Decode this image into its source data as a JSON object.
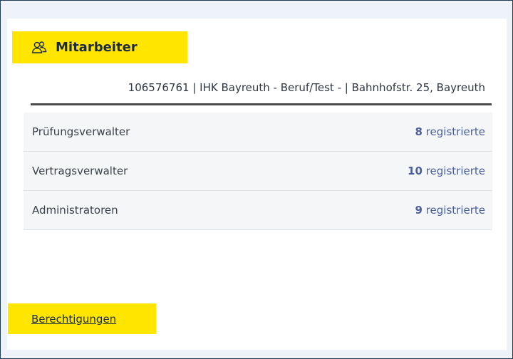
{
  "header": {
    "title": "Mitarbeiter",
    "icon": "users-icon"
  },
  "organization": {
    "line": "106576761 | IHK Bayreuth - Beruf/Test - | Bahnhofstr. 25, Bayreuth"
  },
  "roles": [
    {
      "label": "Prüfungsverwalter",
      "count": "8",
      "suffix": "registrierte"
    },
    {
      "label": "Vertragsverwalter",
      "count": "10",
      "suffix": "registrierte"
    },
    {
      "label": "Administratoren",
      "count": "9",
      "suffix": "registrierte"
    }
  ],
  "footer": {
    "link_label": "Berechtigungen"
  },
  "colors": {
    "highlight": "#ffe500",
    "link": "#4a5f9a",
    "frame_border": "#1f3a5a"
  }
}
